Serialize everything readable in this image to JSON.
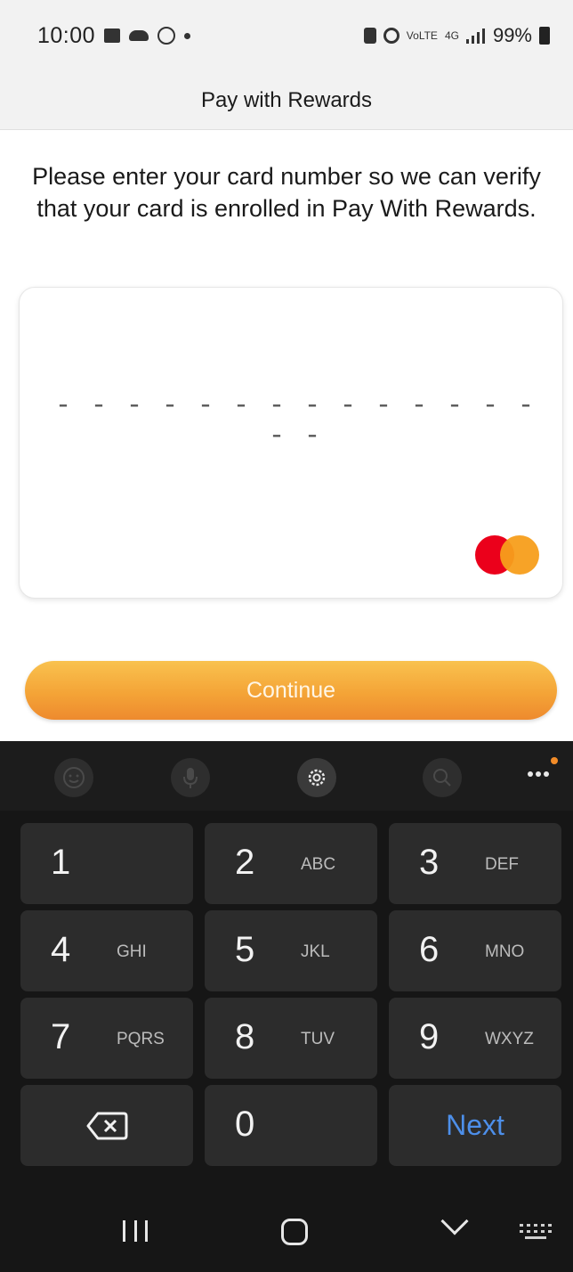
{
  "status_bar": {
    "time": "10:00",
    "battery": "99%",
    "signal_label": "4G",
    "volte_label": "VoLTE"
  },
  "header": {
    "title": "Pay with Rewards"
  },
  "instruction": "Please enter your card number so we can verify that your card is enrolled in Pay With Rewards.",
  "card": {
    "number_placeholder": "- - - -   - - - -   - - - -   - - - -",
    "brand_icon": "mastercard-logo",
    "colors": {
      "red": "#eb001b",
      "orange": "#f79e1b"
    }
  },
  "continue_button": {
    "label": "Continue",
    "color": "#f4a437"
  },
  "keyboard": {
    "toolbar": [
      "emoji-icon",
      "mic-icon",
      "settings-icon",
      "search-icon",
      "more-icon"
    ],
    "keys": [
      {
        "num": "1",
        "letters": ""
      },
      {
        "num": "2",
        "letters": "ABC"
      },
      {
        "num": "3",
        "letters": "DEF"
      },
      {
        "num": "4",
        "letters": "GHI"
      },
      {
        "num": "5",
        "letters": "JKL"
      },
      {
        "num": "6",
        "letters": "MNO"
      },
      {
        "num": "7",
        "letters": "PQRS"
      },
      {
        "num": "8",
        "letters": "TUV"
      },
      {
        "num": "9",
        "letters": "WXYZ"
      },
      {
        "num": "0",
        "letters": ""
      }
    ],
    "next_label": "Next",
    "next_color": "#4d8fea"
  },
  "nav_bar": [
    "recents-icon",
    "home-icon",
    "back-icon",
    "keyboard-switch-icon"
  ]
}
